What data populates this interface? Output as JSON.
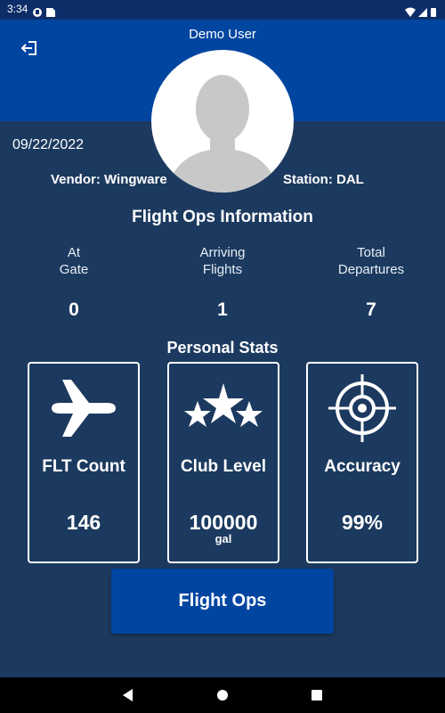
{
  "status_bar": {
    "time": "3:34"
  },
  "header": {
    "title": "Demo User"
  },
  "profile": {
    "date": "09/22/2022",
    "vendor": "Vendor: Wingware",
    "station": "Station: DAL"
  },
  "flight_ops": {
    "title": "Flight Ops Information",
    "columns": [
      {
        "line1": "At",
        "line2": "Gate",
        "value": "0"
      },
      {
        "line1": "Arriving",
        "line2": "Flights",
        "value": "1"
      },
      {
        "line1": "Total",
        "line2": "Departures",
        "value": "7"
      }
    ]
  },
  "personal_stats": {
    "title": "Personal Stats",
    "cards": [
      {
        "icon": "airplane-icon",
        "label": "FLT Count",
        "value": "146",
        "unit": ""
      },
      {
        "icon": "stars-icon",
        "label": "Club Level",
        "value": "100000",
        "unit": "gal"
      },
      {
        "icon": "target-icon",
        "label": "Accuracy",
        "value": "99%",
        "unit": ""
      }
    ]
  },
  "button": {
    "label": "Flight Ops"
  },
  "colors": {
    "background": "#1c3a5f",
    "header": "#0045a0",
    "status_bar": "#0d2d68",
    "button": "#0045a0"
  }
}
